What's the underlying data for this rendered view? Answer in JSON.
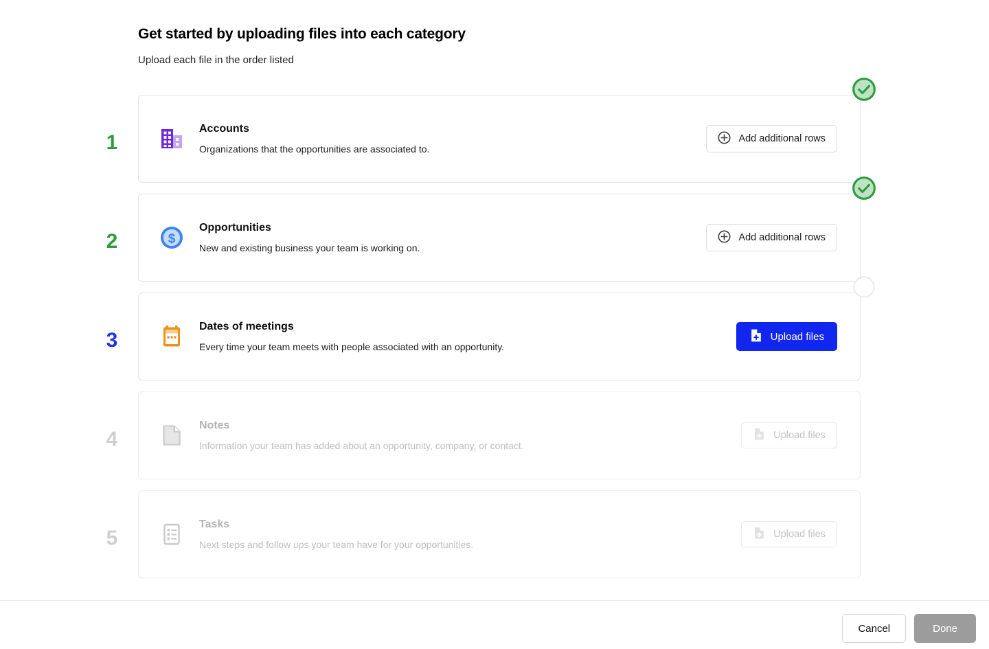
{
  "header": {
    "title": "Get started by uploading files into each category",
    "subtitle": "Upload each file in the order listed"
  },
  "colors": {
    "step_done": "#2e9b3e",
    "step_active": "#1a34f0",
    "step_muted": "#cfcfcf",
    "primary_button": "#1126ee",
    "check_badge": "#2e9b3e",
    "accounts_icon": "#6d28d9",
    "opportunities_icon": "#3b82f6",
    "meetings_icon": "#f09018",
    "disabled_icon": "#d2d2d2",
    "done_button": "#9c9c9c"
  },
  "steps": [
    {
      "number": "1",
      "state": "done",
      "icon": "building-icon",
      "name": "Accounts",
      "description": "Organizations that the opportunities are associated to.",
      "action_label": "Add additional rows",
      "action_icon": "circle-plus-icon",
      "action_type": "secondary",
      "badge": "check-badge"
    },
    {
      "number": "2",
      "state": "done",
      "icon": "dollar-coin-icon",
      "name": "Opportunities",
      "description": "New and existing business your team is working on.",
      "action_label": "Add additional rows",
      "action_icon": "circle-plus-icon",
      "action_type": "secondary",
      "badge": "check-badge"
    },
    {
      "number": "3",
      "state": "active",
      "icon": "calendar-icon",
      "name": "Dates of meetings",
      "description": "Every time your team meets with people associated with an opportunity.",
      "action_label": "Upload files",
      "action_icon": "file-upload-icon",
      "action_type": "primary",
      "badge": "empty-badge"
    },
    {
      "number": "4",
      "state": "muted",
      "icon": "document-icon",
      "name": "Notes",
      "description": "Information your team has added about an opportunity, company, or contact.",
      "action_label": "Upload files",
      "action_icon": "file-upload-icon",
      "action_type": "disabled",
      "badge": "none"
    },
    {
      "number": "5",
      "state": "muted",
      "icon": "task-list-icon",
      "name": "Tasks",
      "description": "Next steps and follow ups your team have for your opportunities.",
      "action_label": "Upload files",
      "action_icon": "file-upload-icon",
      "action_type": "disabled",
      "badge": "none"
    }
  ],
  "footer": {
    "cancel_label": "Cancel",
    "done_label": "Done"
  }
}
